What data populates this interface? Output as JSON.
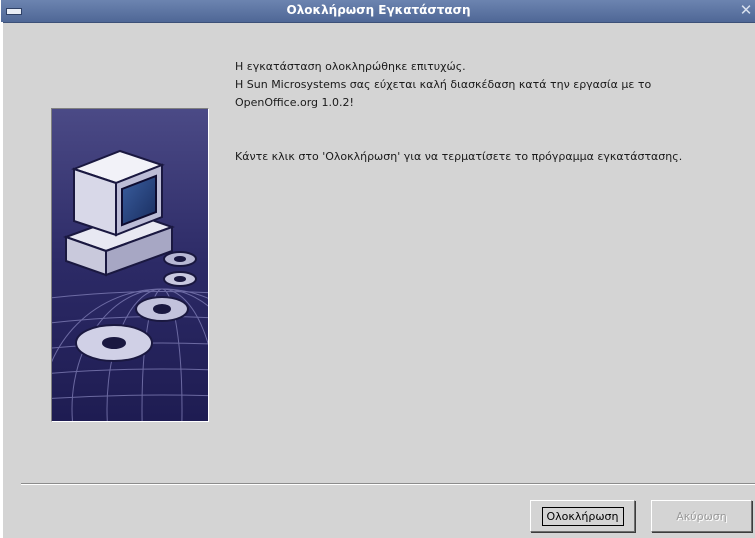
{
  "window": {
    "title": "Ολοκλήρωση Εγκατάσταση",
    "close_glyph": "✕"
  },
  "message": {
    "line1": "Η εγκατάσταση ολοκληρώθηκε επιτυχώς.",
    "line2": "Η Sun Microsystems σας εύχεται καλή διασκέδαση κατά την εργασία με το",
    "line3": "OpenOffice.org 1.0.2!",
    "line4": "Κάντε κλικ στο 'Ολοκλήρωση' για να τερματίσετε το πρόγραμμα εγκατάστασης."
  },
  "buttons": {
    "finish_label": "Ολοκλήρωση",
    "cancel_label": "Ακύρωση",
    "cancel_enabled": false
  },
  "hero": {
    "icon": "computer-with-discs-icon"
  },
  "colors": {
    "titlebar": "#5a72a2",
    "dialog_bg": "#d4d4d4",
    "hero_bg": "#2c2a66"
  }
}
